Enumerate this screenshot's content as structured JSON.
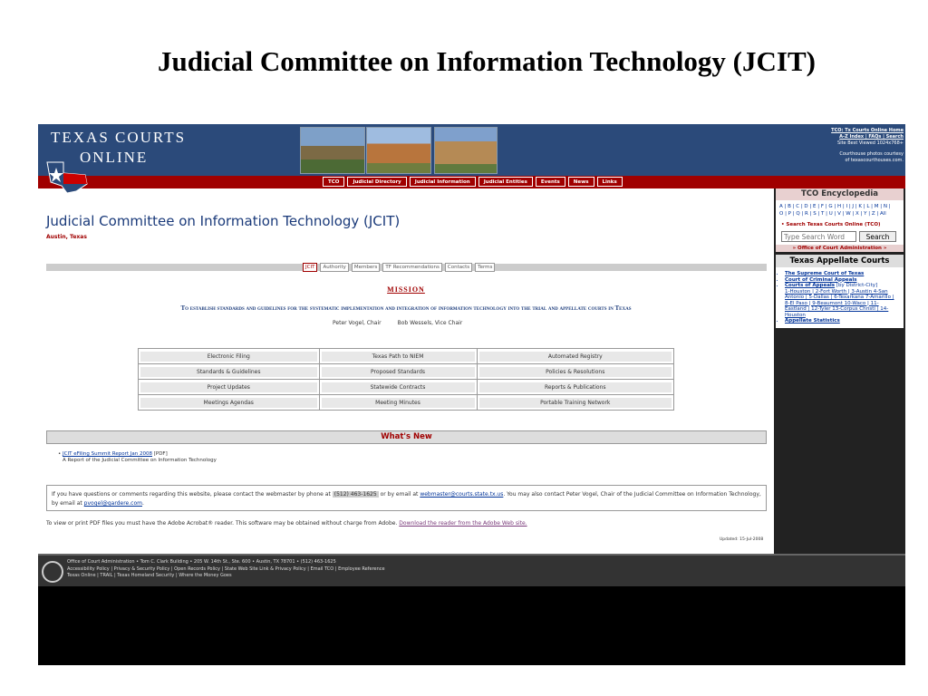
{
  "slide_title": "Judicial Committee on Information Technology (JCIT)",
  "header": {
    "logo_line1": "TEXAS COURTS",
    "logo_line2": "ONLINE",
    "links_line1": "TCO: Tx Courts Online Home",
    "links_line2": "A-Z Index | FAQs | Search",
    "links_line3": "Site Best Viewed 1024x768+",
    "links_line4": "Courthouse photos courtesy",
    "links_line5": "of texascourthouses.com.",
    "nav": [
      "TCO",
      "Judicial Directory",
      "Judicial Information",
      "Judicial Entities",
      "Events",
      "News",
      "Links"
    ]
  },
  "sidebar": {
    "encyclopedia_title": "TCO Encyclopedia",
    "alpha1": "A | B | C | D | E | F | G | H | I | J | K | L | M | N |",
    "alpha2": "O | P | Q | R | S | T | U | V | W | X | Y | Z | All",
    "search_label": "• Search Texas Courts Online (TCO)",
    "search_placeholder": "Type Search Word",
    "search_button": "Search",
    "oca_link": "» Office of Court Administration »",
    "appellate_title": "Texas Appellate Courts",
    "courts": [
      "The Supreme Court of Texas",
      "Court of Criminal Appeals",
      "Courts of Appeals"
    ],
    "courts_note": "[by District-City]",
    "districts": "1-Houston | 2-Fort Worth | 3-Austin 4-San Antonio | 5-Dallas | 6-Texarkana 7-Amarillo | 8-El Paso | 9-Beaumont 10-Waco | 11-Eastland | 12-Tyler 13-Corpus Christi | 14-Houston",
    "stats": "Appellate Statistics"
  },
  "main": {
    "title": "Judicial Committee on Information Technology (JCIT)",
    "subtitle": "Austin, Texas",
    "tabs": [
      "JCIT",
      "Authority",
      "Members",
      "TF Recommendations",
      "Contacts",
      "Terms"
    ],
    "mission_heading": "MISSION",
    "mission_statement": "To establish standards and guidelines for the systematic implementation and integration of information technology into the trial and appellate courts in Texas",
    "chair": "Peter Vogel, Chair",
    "vice_chair": "Bob Wessels, Vice Chair",
    "grid": [
      [
        "Electronic Filing",
        "Texas Path to NIEM",
        "Automated Registry"
      ],
      [
        "Standards & Guidelines",
        "Proposed Standards",
        "Policies & Resolutions"
      ],
      [
        "Project Updates",
        "Statewide Contracts",
        "Reports & Publications"
      ],
      [
        "Meetings Agendas",
        "Meeting Minutes",
        "Portable Training Network"
      ]
    ],
    "whats_new": "What's New",
    "news_link": "JCIT eFiling Summit Report Jan 2008",
    "news_tag": "[PDF]",
    "news_desc": "A Report of the Judicial Committee on Information Technology",
    "contact_text1": "If you have questions or comments regarding this website, please contact the webmaster by phone at",
    "contact_phone": "(512) 463-1625",
    "contact_text2": "or by email at",
    "contact_email": "webmaster@courts.state.tx.us",
    "contact_text3": ". You may also contact Peter Vogel, Chair of the Judicial Committee on Information Technology, by email at",
    "contact_email2": "pvogel@gardere.com",
    "pdf_text": "To view or print PDF files you must have the Adobe Acrobat® reader. This software may be obtained without charge from Adobe.",
    "pdf_link": "Download the reader from the Adobe Web site.",
    "updated": "Updated: 15-Jul-2008"
  },
  "footer": {
    "line1": "Office of Court Administration • Tom C. Clark Building • 205 W. 14th St., Ste. 600 • Austin, TX 78701 • (512) 463-1625",
    "line2": "Accessibility Policy | Privacy & Security Policy | Open Records Policy | State Web Site Link & Privacy Policy | Email TCO | Employee Reference",
    "line3": "Texas Online | TRAIL | Texas Homeland Security | Where the Money Goes"
  },
  "colors": {
    "header_blue": "#2b4a7a",
    "nav_red": "#a00000",
    "link_blue": "#003399"
  }
}
